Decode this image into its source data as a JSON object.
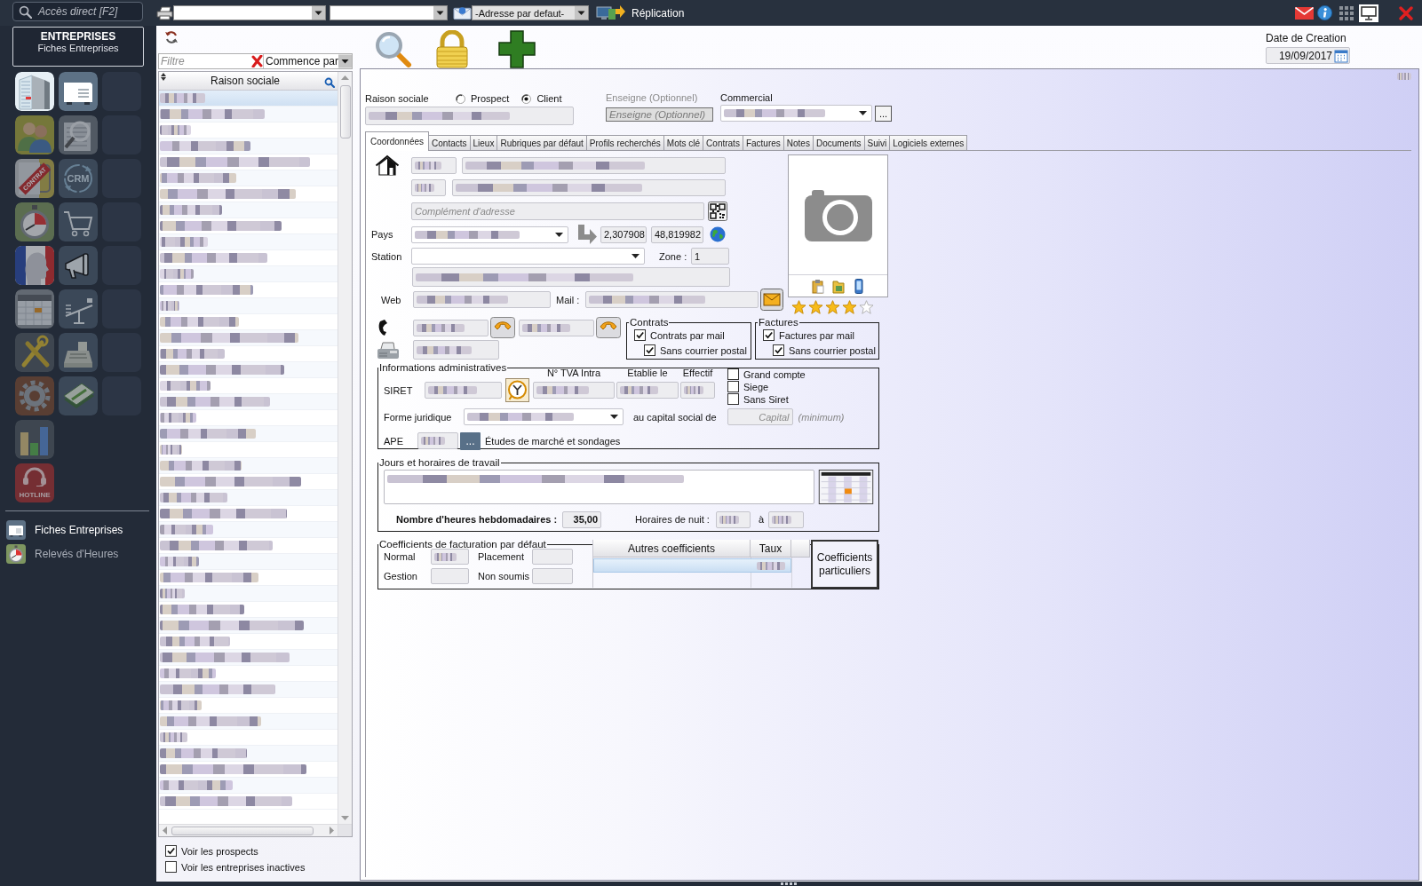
{
  "top_bar": {
    "search": {
      "placeholder": "Accès direct [F2]"
    },
    "tools": [
      {
        "kind": "printer-select"
      },
      {
        "kind": "select"
      },
      {
        "kind": "address-select",
        "value": "-Adresse par defaut-"
      },
      {
        "kind": "replication",
        "label": "Réplication"
      }
    ],
    "window_icons": [
      {
        "kind": "mail"
      },
      {
        "kind": "info"
      },
      {
        "kind": "apps"
      },
      {
        "kind": "monitor"
      },
      {
        "kind": "close"
      }
    ]
  },
  "sidebar": {
    "header": {
      "title": "ENTREPRISES",
      "subtitle": "Fiches Entreprises"
    },
    "tiles": [
      {
        "kind": "building",
        "active": true
      },
      {
        "kind": "card-file",
        "active": true
      },
      {
        "kind": "empty"
      },
      {
        "kind": "people",
        "active": false
      },
      {
        "kind": "magnifier-document",
        "active": false
      },
      {
        "kind": "empty"
      },
      {
        "kind": "contract",
        "text": "CONTRAT",
        "active": false
      },
      {
        "kind": "crm",
        "text": "CRM",
        "active": false
      },
      {
        "kind": "empty"
      },
      {
        "kind": "stopwatch",
        "active": false
      },
      {
        "kind": "cart",
        "active": false
      },
      {
        "kind": "empty"
      },
      {
        "kind": "profile",
        "active": false
      },
      {
        "kind": "megaphone",
        "active": false
      },
      {
        "kind": "empty"
      },
      {
        "kind": "calendar",
        "active": false
      },
      {
        "kind": "balance",
        "active": false
      },
      {
        "kind": "empty"
      },
      {
        "kind": "tools",
        "active": false
      },
      {
        "kind": "cash-register",
        "active": false
      },
      {
        "kind": "empty"
      },
      {
        "kind": "gear",
        "active": false
      },
      {
        "kind": "banknotes",
        "active": false
      },
      {
        "kind": "empty"
      },
      {
        "kind": "bar-chart",
        "active": false
      },
      {
        "kind": "hotline",
        "text": "HOTLINE",
        "active": false
      }
    ],
    "recent": [
      {
        "kind": "card-file",
        "label": "Fiches Entreprises",
        "selected": true
      },
      {
        "kind": "stopwatch",
        "label": "Relevés d'Heures",
        "selected": false
      }
    ]
  },
  "actions": [
    {
      "kind": "search"
    },
    {
      "kind": "lock"
    },
    {
      "kind": "add"
    }
  ],
  "date_created": {
    "label": "Date de Creation",
    "value": "19/09/2017"
  },
  "list_panel": {
    "refresh": true,
    "filter": {
      "placeholder": "Filtre",
      "mode": "Commence par"
    },
    "column": "Raison sociale",
    "rows": [
      {
        "selected": true,
        "redacted": true
      },
      {
        "selected": false,
        "redacted": true
      },
      {
        "selected": false,
        "redacted": true
      },
      {
        "selected": false,
        "redacted": true
      },
      {
        "selected": false,
        "redacted": true
      },
      {
        "selected": false,
        "redacted": true
      },
      {
        "selected": false,
        "redacted": true
      },
      {
        "selected": false,
        "redacted": true
      },
      {
        "selected": false,
        "redacted": true
      },
      {
        "selected": false,
        "redacted": true
      },
      {
        "selected": false,
        "redacted": true
      },
      {
        "selected": false,
        "redacted": true
      },
      {
        "selected": false,
        "redacted": true
      },
      {
        "selected": false,
        "redacted": true
      },
      {
        "selected": false,
        "redacted": true
      },
      {
        "selected": false,
        "redacted": true
      },
      {
        "selected": false,
        "redacted": true
      },
      {
        "selected": false,
        "redacted": true
      },
      {
        "selected": false,
        "redacted": true
      },
      {
        "selected": false,
        "redacted": true
      },
      {
        "selected": false,
        "redacted": true
      },
      {
        "selected": false,
        "redacted": true
      },
      {
        "selected": false,
        "redacted": true
      },
      {
        "selected": false,
        "redacted": true
      },
      {
        "selected": false,
        "redacted": true
      },
      {
        "selected": false,
        "redacted": true
      },
      {
        "selected": false,
        "redacted": true
      },
      {
        "selected": false,
        "redacted": true
      },
      {
        "selected": false,
        "redacted": true
      },
      {
        "selected": false,
        "redacted": true
      },
      {
        "selected": false,
        "redacted": true
      },
      {
        "selected": false,
        "redacted": true
      },
      {
        "selected": false,
        "redacted": true
      },
      {
        "selected": false,
        "redacted": true
      },
      {
        "selected": false,
        "redacted": true
      },
      {
        "selected": false,
        "redacted": true
      },
      {
        "selected": false,
        "redacted": true
      },
      {
        "selected": false,
        "redacted": true
      },
      {
        "selected": false,
        "redacted": true
      },
      {
        "selected": false,
        "redacted": true
      },
      {
        "selected": false,
        "redacted": true
      },
      {
        "selected": false,
        "redacted": true
      },
      {
        "selected": false,
        "redacted": true
      },
      {
        "selected": false,
        "redacted": true
      },
      {
        "selected": false,
        "redacted": true
      }
    ],
    "options": [
      {
        "label": "Voir les prospects",
        "checked": true
      },
      {
        "label": "Voir les entreprises inactives",
        "checked": false
      }
    ]
  },
  "form": {
    "corner_mark": {
      "redacted": true
    },
    "company_name": {
      "label": "Raison sociale",
      "redacted": true
    },
    "customer_type": [
      {
        "label": "Prospect",
        "selected": false
      },
      {
        "label": "Client",
        "selected": true
      }
    ],
    "sign": {
      "label": "Enseigne (Optionnel)",
      "placeholder": "Enseigne (Optionnel)",
      "disabled": true
    },
    "sales_rep": {
      "label": "Commercial",
      "redacted": true,
      "button": "..."
    },
    "tabs": [
      {
        "label": "Coordonnées",
        "selected": true
      },
      {
        "label": "Contacts",
        "selected": false
      },
      {
        "label": "Lieux",
        "selected": false
      },
      {
        "label": "Rubriques par défaut",
        "selected": false
      },
      {
        "label": "Profils recherchés",
        "selected": false
      },
      {
        "label": "Mots clé",
        "selected": false
      },
      {
        "label": "Contrats",
        "selected": false
      },
      {
        "label": "Factures",
        "selected": false
      },
      {
        "label": "Notes",
        "selected": false
      },
      {
        "label": "Documents",
        "selected": false
      },
      {
        "label": "Suivi",
        "selected": false
      },
      {
        "label": "Logiciels externes",
        "selected": false
      }
    ],
    "address": {
      "lines": [
        [
          {
            "redacted": true
          },
          {
            "redacted": true
          }
        ],
        [
          {
            "redacted": true
          },
          {
            "redacted": true
          }
        ]
      ],
      "complement": {
        "placeholder": "Complément d'adresse"
      },
      "country": {
        "label": "Pays",
        "redacted": true
      },
      "coordinates": [
        {
          "value": "2,307908"
        },
        {
          "value": "48,819982"
        }
      ],
      "station": {
        "label": "Station"
      },
      "zone": {
        "label": "Zone :",
        "value": "1"
      },
      "extra_line": {
        "redacted": true
      },
      "web": {
        "label": "Web",
        "redacted": true
      },
      "mail": {
        "label": "Mail :",
        "redacted": true
      },
      "phones": [
        {
          "redacted": true
        },
        {
          "redacted": true
        }
      ],
      "fax": {
        "redacted": true
      }
    },
    "photo": {
      "stars": 4
    },
    "contracts": {
      "title": "Contrats",
      "options": [
        {
          "label": "Contrats par mail",
          "checked": true
        },
        {
          "label": "Sans courrier postal",
          "checked": true
        }
      ]
    },
    "invoices": {
      "title": "Factures",
      "options": [
        {
          "label": "Factures par mail",
          "checked": true
        },
        {
          "label": "Sans courrier postal",
          "checked": true
        }
      ]
    },
    "admin": {
      "title": "Informations administratives",
      "siret": {
        "label": "SIRET",
        "redacted": true
      },
      "vat": {
        "label": "N° TVA Intra",
        "redacted": true
      },
      "established": {
        "label": "Etablie le",
        "redacted": true
      },
      "headcount": {
        "label": "Effectif",
        "redacted": true
      },
      "flags": [
        {
          "label": "Grand compte",
          "checked": false
        },
        {
          "label": "Siege",
          "checked": false
        },
        {
          "label": "Sans Siret",
          "checked": false
        }
      ],
      "legal_form": {
        "label": "Forme juridique",
        "redacted": true
      },
      "capital": {
        "label": "au capital social de",
        "placeholder": "Capital",
        "note": "(minimum)"
      },
      "ape": {
        "label": "APE",
        "redacted": true,
        "button": "...",
        "description": "Études de marché et sondages"
      }
    },
    "hours": {
      "title": "Jours et horaires de travail",
      "schedule": {
        "redacted": true
      },
      "weekly": {
        "label": "Nombre d'heures hebdomadaires :",
        "value": "35,00"
      },
      "night": {
        "label": "Horaires de nuit :",
        "from": {
          "redacted": true
        },
        "separator": "à",
        "to": {
          "redacted": true
        }
      }
    },
    "coefficients": {
      "title": "Coefficients de facturation par défaut",
      "fields": [
        {
          "label": "Normal",
          "redacted": true
        },
        {
          "label": "Placement"
        },
        {
          "label": "Gestion"
        },
        {
          "label": "Non soumis"
        }
      ],
      "table": {
        "columns": [
          "Autres coefficients",
          "Taux"
        ],
        "rows": [
          {
            "selected": true,
            "rate": {
              "redacted": true
            }
          }
        ]
      },
      "button": "Coefficients particuliers"
    }
  }
}
